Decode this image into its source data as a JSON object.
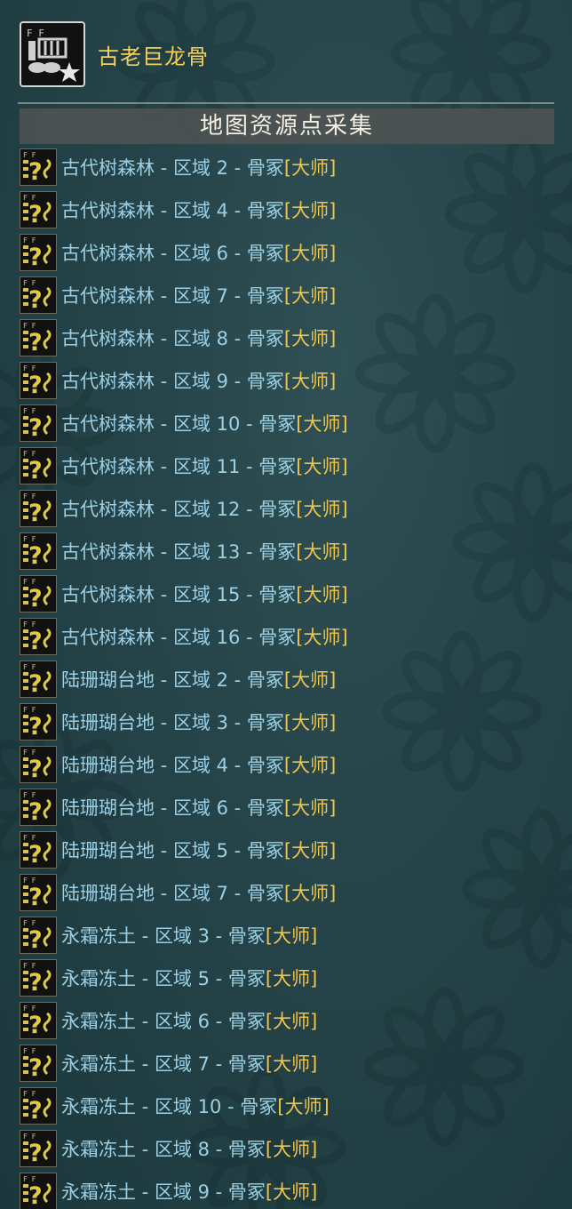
{
  "item": {
    "name": "古老巨龙骨",
    "icon": "bone-material-icon"
  },
  "section": {
    "title": "地图资源点采集"
  },
  "rank_label": "[大师]",
  "separator": " - ",
  "colors": {
    "location_text": "#9cd0e4",
    "rank_text": "#f1c54c",
    "item_name": "#f5cf58",
    "background": "#26454a"
  },
  "locations": [
    {
      "map": "古代树森林",
      "area": "区域 2",
      "node": "骨冢"
    },
    {
      "map": "古代树森林",
      "area": "区域 4",
      "node": "骨冢"
    },
    {
      "map": "古代树森林",
      "area": "区域 6",
      "node": "骨冢"
    },
    {
      "map": "古代树森林",
      "area": "区域 7",
      "node": "骨冢"
    },
    {
      "map": "古代树森林",
      "area": "区域 8",
      "node": "骨冢"
    },
    {
      "map": "古代树森林",
      "area": "区域 9",
      "node": "骨冢"
    },
    {
      "map": "古代树森林",
      "area": "区域 10",
      "node": "骨冢"
    },
    {
      "map": "古代树森林",
      "area": "区域 11",
      "node": "骨冢"
    },
    {
      "map": "古代树森林",
      "area": "区域 12",
      "node": "骨冢"
    },
    {
      "map": "古代树森林",
      "area": "区域 13",
      "node": "骨冢"
    },
    {
      "map": "古代树森林",
      "area": "区域 15",
      "node": "骨冢"
    },
    {
      "map": "古代树森林",
      "area": "区域 16",
      "node": "骨冢"
    },
    {
      "map": "陆珊瑚台地",
      "area": "区域 2",
      "node": "骨冢"
    },
    {
      "map": "陆珊瑚台地",
      "area": "区域 3",
      "node": "骨冢"
    },
    {
      "map": "陆珊瑚台地",
      "area": "区域 4",
      "node": "骨冢"
    },
    {
      "map": "陆珊瑚台地",
      "area": "区域 6",
      "node": "骨冢"
    },
    {
      "map": "陆珊瑚台地",
      "area": "区域 5",
      "node": "骨冢"
    },
    {
      "map": "陆珊瑚台地",
      "area": "区域 7",
      "node": "骨冢"
    },
    {
      "map": "永霜冻土",
      "area": "区域 3",
      "node": "骨冢"
    },
    {
      "map": "永霜冻土",
      "area": "区域 5",
      "node": "骨冢"
    },
    {
      "map": "永霜冻土",
      "area": "区域 6",
      "node": "骨冢"
    },
    {
      "map": "永霜冻土",
      "area": "区域 7",
      "node": "骨冢"
    },
    {
      "map": "永霜冻土",
      "area": "区域 10",
      "node": "骨冢"
    },
    {
      "map": "永霜冻土",
      "area": "区域 8",
      "node": "骨冢"
    },
    {
      "map": "永霜冻土",
      "area": "区域 9",
      "node": "骨冢"
    }
  ]
}
